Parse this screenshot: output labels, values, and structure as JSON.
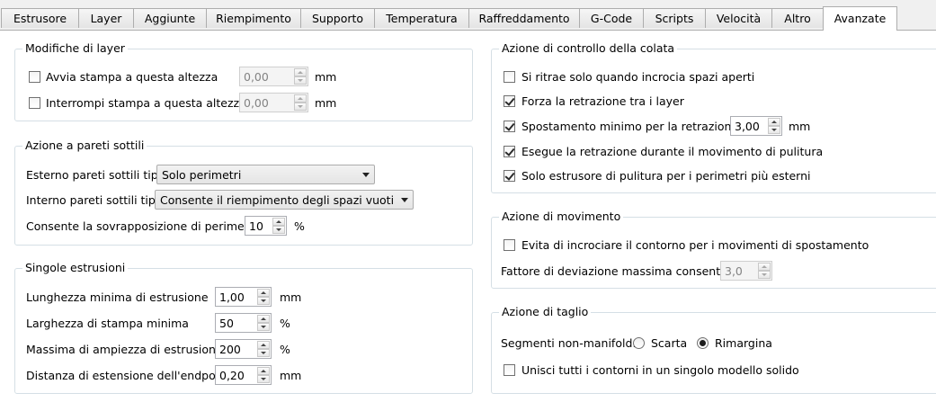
{
  "tabs": [
    {
      "label": "Estrusore"
    },
    {
      "label": "Layer"
    },
    {
      "label": "Aggiunte"
    },
    {
      "label": "Riempimento"
    },
    {
      "label": "Supporto"
    },
    {
      "label": "Temperatura"
    },
    {
      "label": "Raffreddamento"
    },
    {
      "label": "G-Code"
    },
    {
      "label": "Scripts"
    },
    {
      "label": "Velocità"
    },
    {
      "label": "Altro"
    },
    {
      "label": "Avanzate",
      "active": true
    }
  ],
  "layer_mods": {
    "title": "Modifiche di layer",
    "start": {
      "label": "Avvia stampa a questa altezza",
      "checked": false,
      "value": "0,00",
      "unit": "mm",
      "enabled": false
    },
    "stop": {
      "label": "Interrompi stampa a questa altezza",
      "checked": false,
      "value": "0,00",
      "unit": "mm",
      "enabled": false
    }
  },
  "thin_walls": {
    "title": "Azione a pareti sottili",
    "outer": {
      "label": "Esterno pareti sottili tipo",
      "value": "Solo perimetri"
    },
    "inner": {
      "label": "Interno pareti sottili tipo",
      "value": "Consente il riempimento degli spazi vuoti"
    },
    "overlap": {
      "label": "Consente la sovrapposizione di perimetro",
      "value": "10",
      "unit": "%"
    }
  },
  "single_ext": {
    "title": "Singole estrusioni",
    "rows": [
      {
        "label": "Lunghezza minima di estrusione",
        "value": "1,00",
        "unit": "mm"
      },
      {
        "label": "Larghezza di stampa minima",
        "value": "50",
        "unit": "%"
      },
      {
        "label": "Massima di ampiezza di estrusione",
        "value": "200",
        "unit": "%"
      },
      {
        "label": "Distanza di estensione dell'endpoint",
        "value": "0,20",
        "unit": "mm"
      }
    ]
  },
  "ooze": {
    "title": "Azione di controllo della colata",
    "items": [
      {
        "label": "Si ritrae solo quando incrocia spazi aperti",
        "checked": false
      },
      {
        "label": "Forza la retrazione tra i layer",
        "checked": true
      },
      {
        "label": "Spostamento minimo per la retrazione",
        "checked": true,
        "value": "3,00",
        "unit": "mm"
      },
      {
        "label": "Esegue la retrazione durante il movimento di pulitura",
        "checked": true
      },
      {
        "label": "Solo estrusore di pulitura per i perimetri più esterni",
        "checked": true
      }
    ]
  },
  "movement": {
    "title": "Azione di movimento",
    "avoid": {
      "label": "Evita di incrociare il contorno per i movimenti di spostamento",
      "checked": false
    },
    "deviation": {
      "label": "Fattore di deviazione massima consentita",
      "value": "3,0",
      "enabled": false
    }
  },
  "slicing": {
    "title": "Azione di taglio",
    "nonmanifold": {
      "label": "Segmenti non-manifold:",
      "options": [
        "Scarta",
        "Rimargina"
      ],
      "selected": "Rimargina"
    },
    "merge": {
      "label": "Unisci tutti i contorni in un singolo modello solido",
      "checked": false
    }
  }
}
